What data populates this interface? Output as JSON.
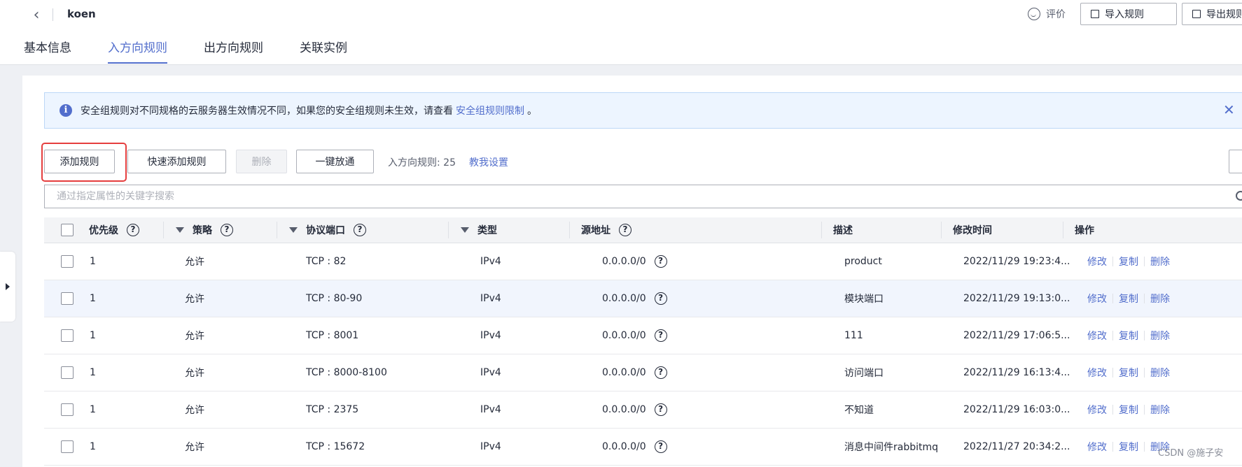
{
  "header": {
    "back_icon": "chevron-left-icon",
    "title": "koen",
    "rate_label": "评价",
    "import_label": "导入规则",
    "export_label": "导出规则"
  },
  "tabs": [
    {
      "label": "基本信息",
      "active": false
    },
    {
      "label": "入方向规则",
      "active": true
    },
    {
      "label": "出方向规则",
      "active": false
    },
    {
      "label": "关联实例",
      "active": false
    }
  ],
  "alert": {
    "text": "安全组规则对不同规格的云服务器生效情况不同，如果您的安全组规则未生效，请查看",
    "link": "安全组规则限制",
    "suffix": "。",
    "close": "✕"
  },
  "toolbar": {
    "add_rule": "添加规则",
    "quick_add": "快速添加规则",
    "delete": "删除",
    "one_click": "一键放通",
    "rule_count": "入方向规则: 25",
    "help": "教我设置"
  },
  "search": {
    "placeholder": "通过指定属性的关键字搜索"
  },
  "table": {
    "headers": {
      "priority": "优先级",
      "policy": "策略",
      "protocol": "协议端口",
      "type": "类型",
      "source": "源地址",
      "desc": "描述",
      "modified": "修改时间",
      "ops": "操作"
    },
    "op_labels": {
      "edit": "修改",
      "copy": "复制",
      "delete": "删除"
    },
    "rows": [
      {
        "priority": "1",
        "policy": "允许",
        "protocol": "TCP : 82",
        "type": "IPv4",
        "source": "0.0.0.0/0",
        "desc": "product",
        "modified": "2022/11/29 19:23:4...",
        "highlight": false
      },
      {
        "priority": "1",
        "policy": "允许",
        "protocol": "TCP : 80-90",
        "type": "IPv4",
        "source": "0.0.0.0/0",
        "desc": "模块端口",
        "modified": "2022/11/29 19:13:0...",
        "highlight": true
      },
      {
        "priority": "1",
        "policy": "允许",
        "protocol": "TCP : 8001",
        "type": "IPv4",
        "source": "0.0.0.0/0",
        "desc": "111",
        "modified": "2022/11/29 17:06:5...",
        "highlight": false
      },
      {
        "priority": "1",
        "policy": "允许",
        "protocol": "TCP : 8000-8100",
        "type": "IPv4",
        "source": "0.0.0.0/0",
        "desc": "访问端口",
        "modified": "2022/11/29 16:13:4...",
        "highlight": false
      },
      {
        "priority": "1",
        "policy": "允许",
        "protocol": "TCP : 2375",
        "type": "IPv4",
        "source": "0.0.0.0/0",
        "desc": "不知道",
        "modified": "2022/11/29 16:03:0...",
        "highlight": false
      },
      {
        "priority": "1",
        "policy": "允许",
        "protocol": "TCP : 15672",
        "type": "IPv4",
        "source": "0.0.0.0/0",
        "desc": "消息中间件rabbitmq",
        "modified": "2022/11/27 20:34:2...",
        "highlight": false
      }
    ]
  },
  "watermark": "CSDN @施子安",
  "colors": {
    "accent": "#526ecc",
    "highlight_frame": "#e53e3e",
    "alert_bg": "#edf5ff"
  }
}
